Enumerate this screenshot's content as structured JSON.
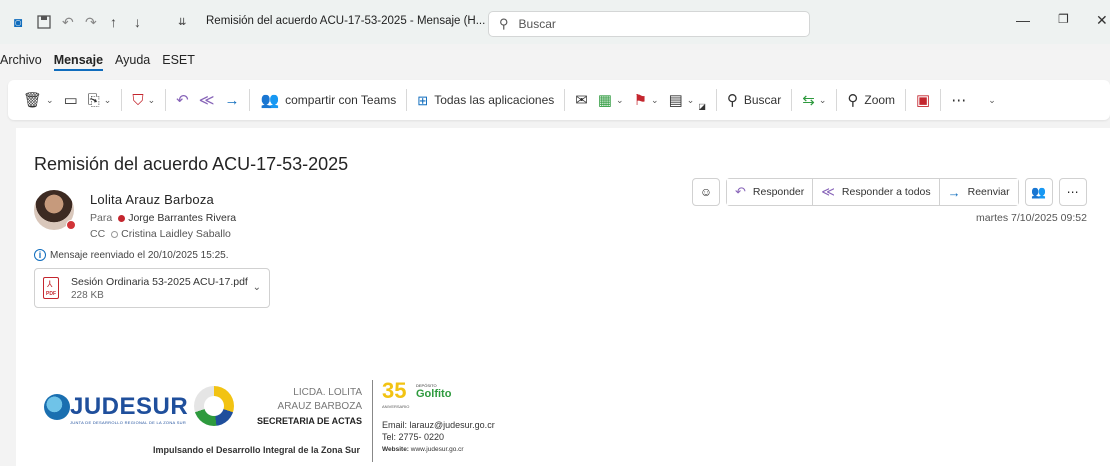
{
  "window": {
    "title": "Remisión del acuerdo ACU-17-53-2025  -  Mensaje (H...",
    "search_placeholder": "Buscar",
    "icons": [
      "outlook-icon",
      "save-icon",
      "undo-icon",
      "redo-icon",
      "up-arrow-icon",
      "down-arrow-icon",
      "customize-icon"
    ]
  },
  "menu": {
    "tabs": [
      "Archivo",
      "Mensaje",
      "Ayuda",
      "ESET"
    ],
    "active": "Mensaje"
  },
  "ribbon": {
    "teams_label": "compartir con Teams",
    "apps_label": "Todas las aplicaciones",
    "search_label": "Buscar",
    "zoom_label": "Zoom"
  },
  "message": {
    "subject": "Remisión del acuerdo ACU-17-53-2025",
    "sender": "Lolita  Arauz Barboza",
    "to_label": "Para",
    "to_name": "Jorge Barrantes Rivera",
    "cc_label": "CC",
    "cc_name": "Cristina Laidley Saballo",
    "forwarded_note": "Mensaje reenviado el 20/10/2025 15:25.",
    "date": "martes 7/10/2025 09:52"
  },
  "attachment": {
    "name": "Sesión Ordinaria 53-2025 ACU-17.pdf",
    "size": "228 KB",
    "type_label": "PDF"
  },
  "actions": {
    "reply": "Responder",
    "reply_all": "Responder a todos",
    "forward": "Reenviar"
  },
  "signature": {
    "org": "JUDESUR",
    "org_sub": "JUNTA DE DESARROLLO REGIONAL DE LA ZONA SUR",
    "title_line1": "LICDA. LOLITA",
    "title_line2": "ARAUZ BARBOZA",
    "title_line3": "SECRETARIA DE ACTAS",
    "tagline": "Impulsando el Desarrollo Integral de la Zona Sur",
    "anniversary": "35",
    "anniversary_sub": "ANIVERSARIO",
    "golfito_top": "DEPÓSITO",
    "golfito": "Golfito",
    "email": "Email: larauz@judesur.go.cr",
    "tel": "Tel: 2775- 0220",
    "web_label": "Website:",
    "web_url": "www.judesur.go.cr"
  },
  "colors": {
    "accent": "#0f6cbd",
    "presence_busy": "#d13438",
    "judesur_blue": "#1f4f9c",
    "golfito_green": "#2e9a3e",
    "anniversary_yellow": "#f2c313"
  }
}
